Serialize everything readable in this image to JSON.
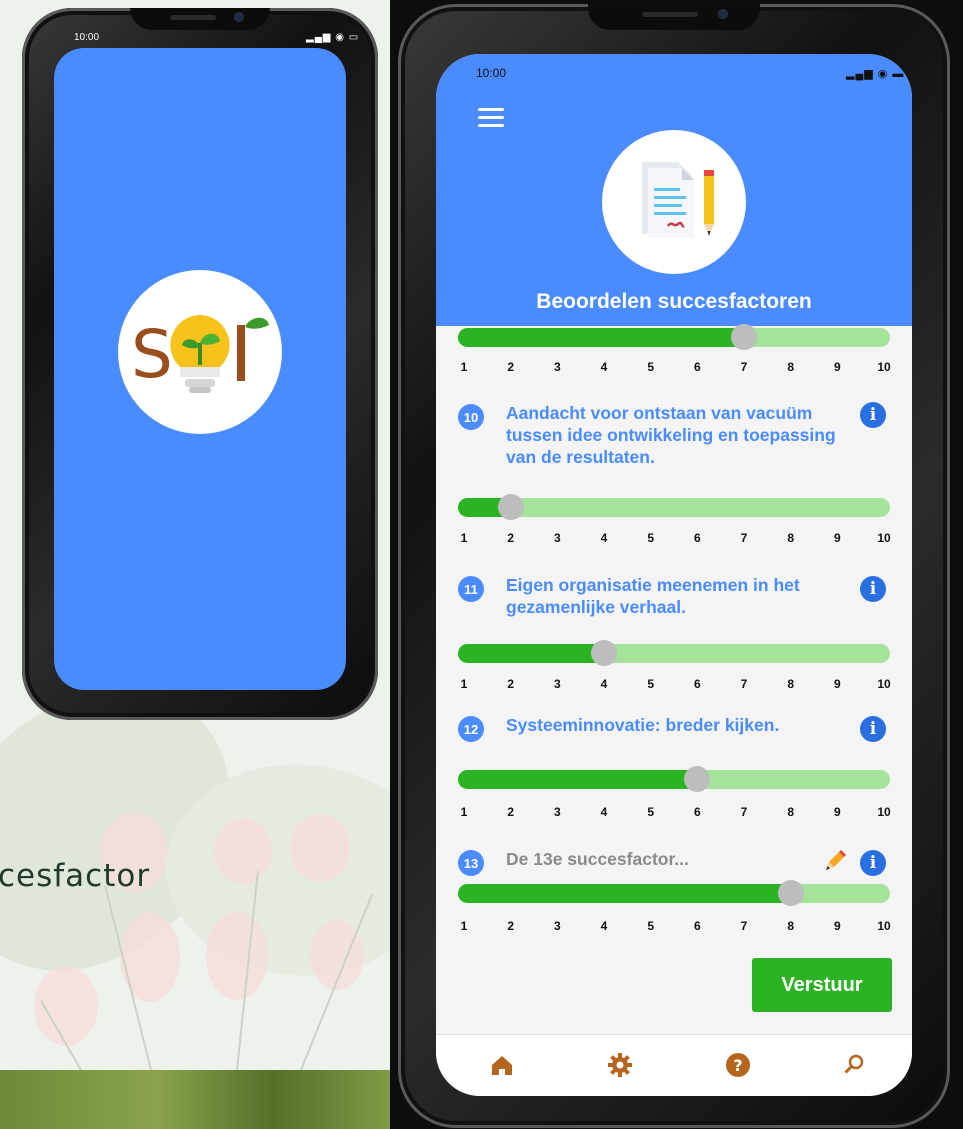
{
  "background": {
    "partial_text": "cesfactor"
  },
  "splash_phone": {
    "status_time": "10:00",
    "status_icons": "signal wifi battery",
    "logo": {
      "letters": "SOL",
      "icon": "lightbulb-sprout-icon"
    },
    "background_color": "#4a8cff"
  },
  "app_phone": {
    "status_time": "10:00",
    "menu_icon": "hamburger-menu-icon",
    "header_icon": "document-pencil-icon",
    "title": "Beoordelen succesfactoren",
    "scale_labels": [
      "1",
      "2",
      "3",
      "4",
      "5",
      "6",
      "7",
      "8",
      "9",
      "10"
    ],
    "top_slider": {
      "value": 7
    },
    "questions": [
      {
        "number": "10",
        "text": "Aandacht voor ontstaan van vacuüm tussen idee ontwikkeling en toepassing van de resultaten.",
        "value": 2,
        "info_icon": "info-icon"
      },
      {
        "number": "11",
        "text": "Eigen organisatie meenemen in het gezamenlijke verhaal.",
        "value": 4,
        "info_icon": "info-icon"
      },
      {
        "number": "12",
        "text": "Systeeminnovatie: breder kijken.",
        "value": 6,
        "info_icon": "info-icon"
      },
      {
        "number": "13",
        "text": "De 13e succesfactor...",
        "value": 8,
        "info_icon": "info-icon",
        "edit_icon": "pencil-icon"
      }
    ],
    "send_label": "Verstuur",
    "nav": [
      "home-icon",
      "gear-icon",
      "help-icon",
      "search-icon"
    ],
    "colors": {
      "primary": "#4a8cff",
      "green": "#2bb324",
      "track": "#a6e39a",
      "thumb": "#bdbdbd"
    }
  }
}
